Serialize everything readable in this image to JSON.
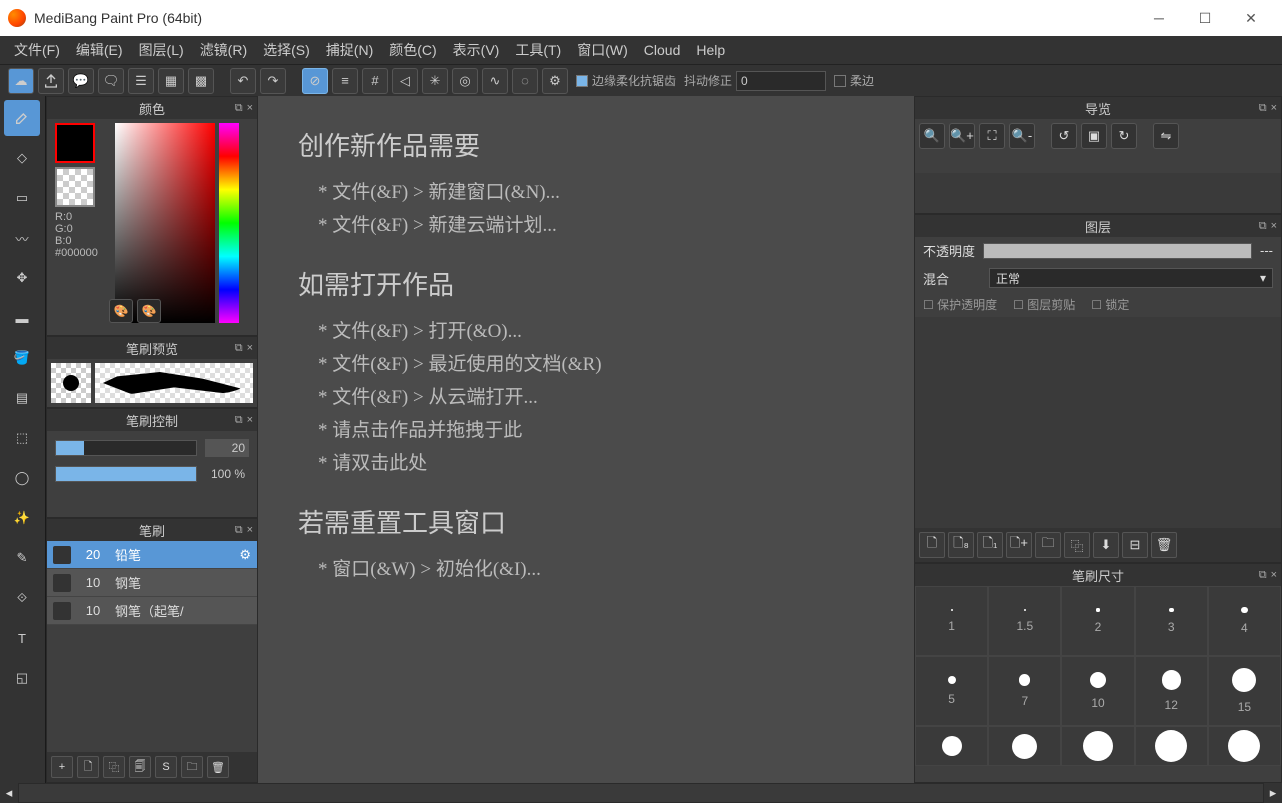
{
  "app": {
    "title": "MediBang Paint Pro (64bit)"
  },
  "menu": [
    "文件(F)",
    "编辑(E)",
    "图层(L)",
    "滤镜(R)",
    "选择(S)",
    "捕捉(N)",
    "颜色(C)",
    "表示(V)",
    "工具(T)",
    "窗口(W)",
    "Cloud",
    "Help"
  ],
  "toolbar": {
    "edge_label": "边缘柔化抗锯齿",
    "shake_label": "抖动修正",
    "shake_value": "0",
    "soft_label": "柔边"
  },
  "panels": {
    "color": {
      "title": "颜色",
      "r": "R:0",
      "g": "G:0",
      "b": "B:0",
      "hex": "#000000"
    },
    "brush_preview": {
      "title": "笔刷预览"
    },
    "brush_control": {
      "title": "笔刷控制",
      "size_val": "20",
      "opacity_val": "100 %"
    },
    "brush": {
      "title": "笔刷",
      "items": [
        {
          "size": "20",
          "name": "铅笔",
          "sel": true
        },
        {
          "size": "10",
          "name": "钢笔",
          "sel": false
        },
        {
          "size": "10",
          "name": "钢笔（起笔/",
          "sel": false
        }
      ]
    }
  },
  "canvas": {
    "sec1_title": "创作新作品需要",
    "sec1_hint1": "* 文件(&F) > 新建窗口(&N)...",
    "sec1_hint2": "* 文件(&F) > 新建云端计划...",
    "sec2_title": "如需打开作品",
    "sec2_hint1": "* 文件(&F) > 打开(&O)...",
    "sec2_hint2": "* 文件(&F) > 最近使用的文档(&R)",
    "sec2_hint3": "* 文件(&F) > 从云端打开...",
    "sec2_hint4": "* 请点击作品并拖拽于此",
    "sec2_hint5": "* 请双击此处",
    "sec3_title": "若需重置工具窗口",
    "sec3_hint1": "* 窗口(&W) > 初始化(&I)..."
  },
  "right": {
    "nav": {
      "title": "导览"
    },
    "layers": {
      "title": "图层",
      "opacity_label": "不透明度",
      "opacity_val": "---",
      "blend_label": "混合",
      "blend_val": "正常",
      "chk1": "保护透明度",
      "chk2": "图层剪贴",
      "chk3": "锁定"
    },
    "brush_size": {
      "title": "笔刷尺寸",
      "sizes": [
        1,
        1.5,
        2,
        3,
        4,
        5,
        7,
        10,
        12,
        15
      ]
    }
  }
}
